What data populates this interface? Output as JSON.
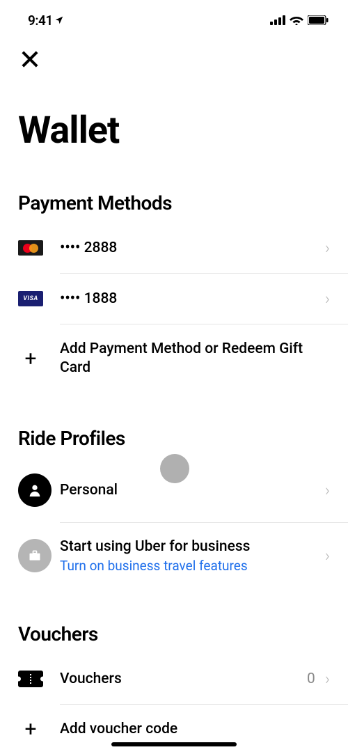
{
  "statusBar": {
    "time": "9:41"
  },
  "page": {
    "title": "Wallet"
  },
  "paymentMethods": {
    "title": "Payment Methods",
    "cards": [
      {
        "type": "mastercard",
        "label": "•••• 2888"
      },
      {
        "type": "visa",
        "label": "•••• 1888"
      }
    ],
    "addLabel": "Add Payment Method or Redeem Gift Card"
  },
  "rideProfiles": {
    "title": "Ride Profiles",
    "personal": {
      "label": "Personal"
    },
    "business": {
      "label": "Start using Uber for business",
      "subLabel": "Turn on business travel features"
    }
  },
  "vouchers": {
    "title": "Vouchers",
    "label": "Vouchers",
    "count": "0",
    "addLabel": "Add voucher code"
  },
  "visaText": "VISA"
}
